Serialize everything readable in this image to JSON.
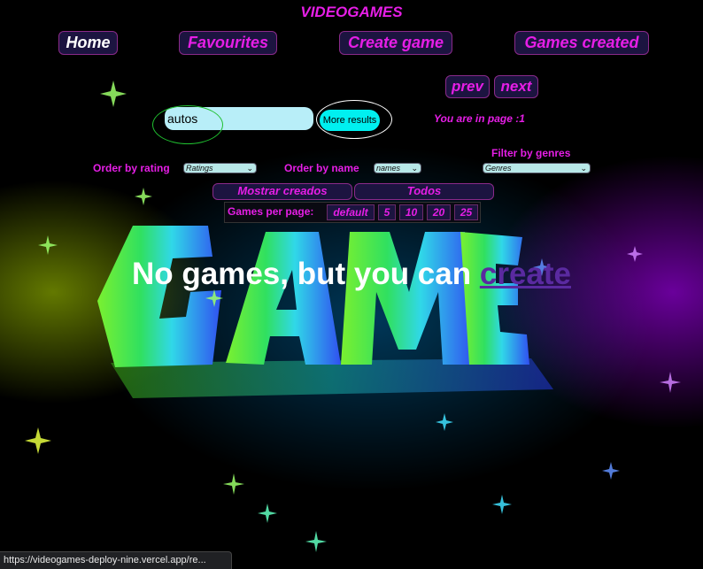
{
  "app": {
    "title": "VIDEOGAMES"
  },
  "nav": {
    "home": "Home",
    "favourites": "Favourites",
    "create_game": "Create game",
    "games_created": "Games created"
  },
  "pager": {
    "prev": "prev",
    "next": "next",
    "page_info": "You are in page :1"
  },
  "search": {
    "value": "autos",
    "button": "More results"
  },
  "filters": {
    "order_rating_label": "Order by rating",
    "order_rating_value": "Ratings",
    "order_name_label": "Order by name",
    "order_name_value": "names",
    "genres_label": "Filter by genres",
    "genres_value": "Genres"
  },
  "source": {
    "created": "Mostrar creados",
    "all": "Todos"
  },
  "games_per_page": {
    "label": "Games per page:",
    "options": [
      "default",
      "5",
      "10",
      "20",
      "25"
    ]
  },
  "empty": {
    "text": "No games, but you can ",
    "link": "create"
  },
  "statusbar": {
    "url": "https://videogames-deploy-nine.vercel.app/re..."
  },
  "colors": {
    "accent": "#e61ee6",
    "button_bg": "#1c1440",
    "search_bg": "#b8eef8",
    "more_bg": "#00f0f0",
    "link": "#5a2aa0"
  }
}
